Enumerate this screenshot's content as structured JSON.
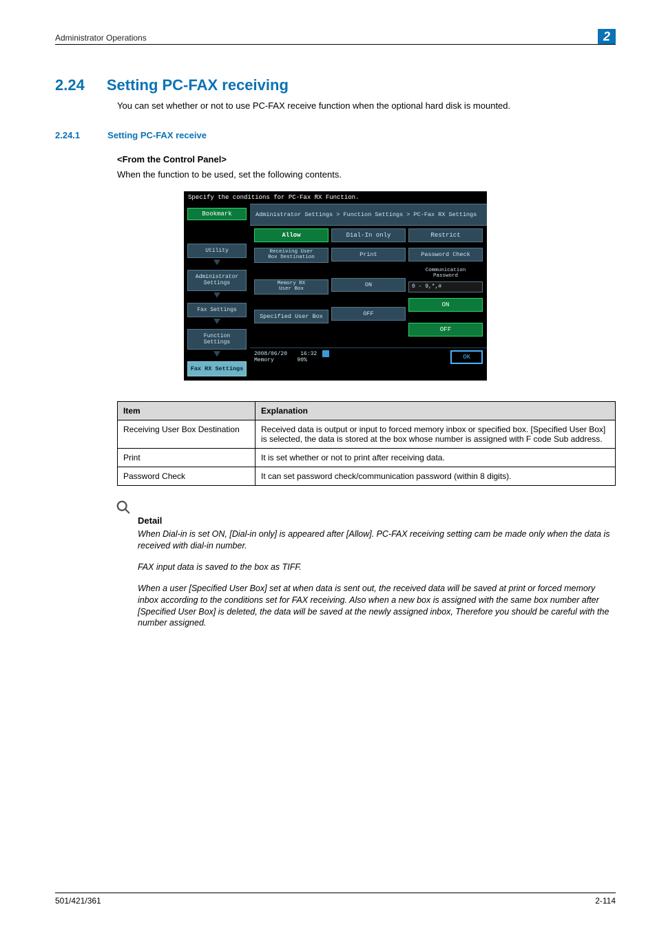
{
  "header": {
    "running_title": "Administrator Operations",
    "chapter_number": "2"
  },
  "section": {
    "number": "2.24",
    "title": "Setting PC-FAX receiving",
    "intro": "You can set whether or not to use PC-FAX receive function when the optional hard disk is mounted."
  },
  "subsection": {
    "number": "2.24.1",
    "title": "Setting PC-FAX receive"
  },
  "panel_heading": "<From the Control Panel>",
  "panel_intro": "When the function to be used, set the following contents.",
  "screenshot": {
    "top_text": "Specify the conditions for PC-Fax RX Function.",
    "bookmark": "Bookmark",
    "nav": {
      "utility": "Utility",
      "admin_settings": "Administrator\nSettings",
      "fax_settings": "Fax Settings",
      "function_settings": "Function\nSettings",
      "current": "Fax RX Settings"
    },
    "breadcrumb": "Administrator Settings > Function Settings > PC-Fax RX Settings",
    "tabs": {
      "allow": "Allow",
      "dialin": "Dial-In only",
      "restrict": "Restrict"
    },
    "rows": {
      "recv_box": "Receiving User\nBox Destination",
      "print": "Print",
      "password_check": "Password Check",
      "comm_pwd": "Communication\nPassword",
      "memory_rx": "Memory RX\nUser Box",
      "on": "ON",
      "specified_box": "Specified User Box",
      "off": "OFF",
      "pwd_hint": "0 - 9,*,#",
      "btn_on": "ON",
      "btn_off": "OFF"
    },
    "footer": {
      "date": "2008/06/20",
      "time": "16:32",
      "memory_label": "Memory",
      "memory_pct": "90%",
      "ok": "OK"
    }
  },
  "table": {
    "head_item": "Item",
    "head_expl": "Explanation",
    "rows": [
      {
        "item": "Receiving User Box Destination",
        "expl": "Received data is output or input to forced memory inbox or specified box. [Specified User Box] is selected, the data is stored at the box whose number is assigned with F code Sub address."
      },
      {
        "item": "Print",
        "expl": "It is set whether or not to print after receiving data."
      },
      {
        "item": "Password Check",
        "expl": "It can set password check/communication password (within 8 digits)."
      }
    ]
  },
  "detail": {
    "title": "Detail",
    "p1": "When Dial-in is set ON, [Dial-in only] is appeared after [Allow]. PC-FAX receiving setting cam be made only when the data is received with dial-in number.",
    "p2": "FAX input data is saved to the box as TIFF.",
    "p3": "When a user [Specified User Box] set at when data is sent out, the received data will be saved at print or forced memory inbox according to the conditions set for FAX receiving. Also when a new box is assigned with the same box number after [Specified User Box] is deleted, the data will be saved at the newly assigned inbox, Therefore you should be careful with the number assigned."
  },
  "footer": {
    "left": "501/421/361",
    "right": "2-114"
  }
}
